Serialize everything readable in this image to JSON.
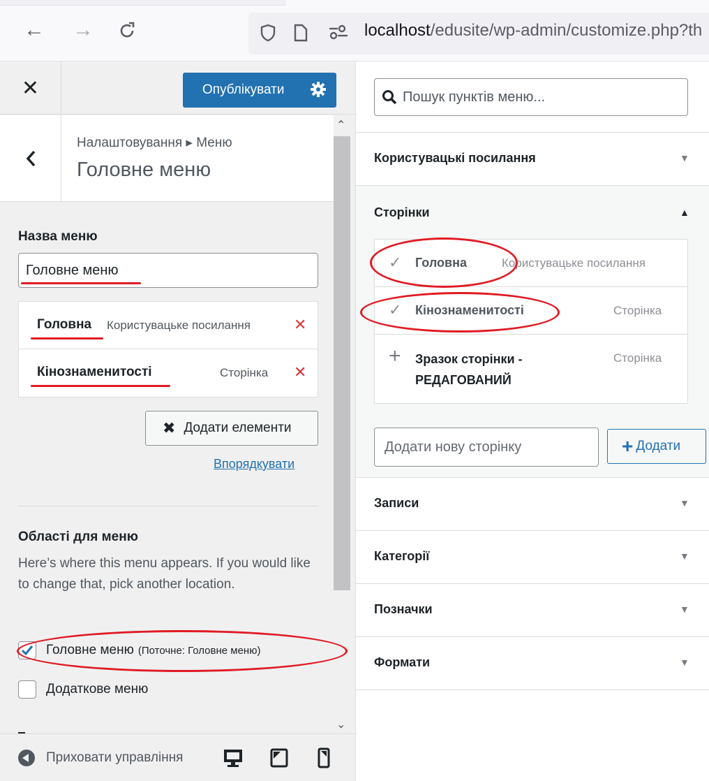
{
  "browser": {
    "url_host": "localhost",
    "url_path": "/edusite/wp-admin/customize.php?th",
    "back_icon": "arrow-left-icon",
    "forward_icon": "arrow-right-icon",
    "reload_icon": "reload-icon"
  },
  "customizer": {
    "publish_label": "Опублікувати",
    "breadcrumb": "Налаштовування ▸ Меню",
    "section_title": "Головне меню",
    "menu_name_label": "Назва меню",
    "menu_name_value": "Головне меню",
    "menu_items": [
      {
        "title": "Головна",
        "type": "Користувацьке посилання"
      },
      {
        "title": "Кінознаменитості",
        "type": "Сторінка"
      }
    ],
    "add_items_label": "Додати елементи",
    "reorder_label": "Впорядкувати",
    "locations_title": "Області для меню",
    "locations_desc": "Here’s where this menu appears. If you would like to change that, pick another location.",
    "locations": [
      {
        "label": "Головне меню",
        "note": "(Поточне: Головне меню)",
        "checked": true
      },
      {
        "label": "Додаткове меню",
        "note": "",
        "checked": false
      }
    ],
    "hide_controls_label": "Приховати управління"
  },
  "available": {
    "search_placeholder": "Пошук пунктів меню...",
    "sections": [
      {
        "title": "Користувацькі посилання",
        "expanded": false
      },
      {
        "title": "Сторінки",
        "expanded": true
      },
      {
        "title": "Записи",
        "expanded": false
      },
      {
        "title": "Категорії",
        "expanded": false
      },
      {
        "title": "Позначки",
        "expanded": false
      },
      {
        "title": "Формати",
        "expanded": false
      }
    ],
    "pages": [
      {
        "title": "Головна",
        "type": "Користувацьке посилання",
        "added": true
      },
      {
        "title": "Кінознаменитості",
        "type": "Сторінка",
        "added": true
      },
      {
        "title": "Зразок сторінки - РЕДАГОВАНИЙ",
        "type": "Сторінка",
        "added": false
      }
    ],
    "new_page_placeholder": "Додати нову сторінку",
    "add_label": "Додати"
  },
  "colors": {
    "primary": "#2271b1",
    "delete": "#d63638",
    "annotation": "#e01b24"
  }
}
